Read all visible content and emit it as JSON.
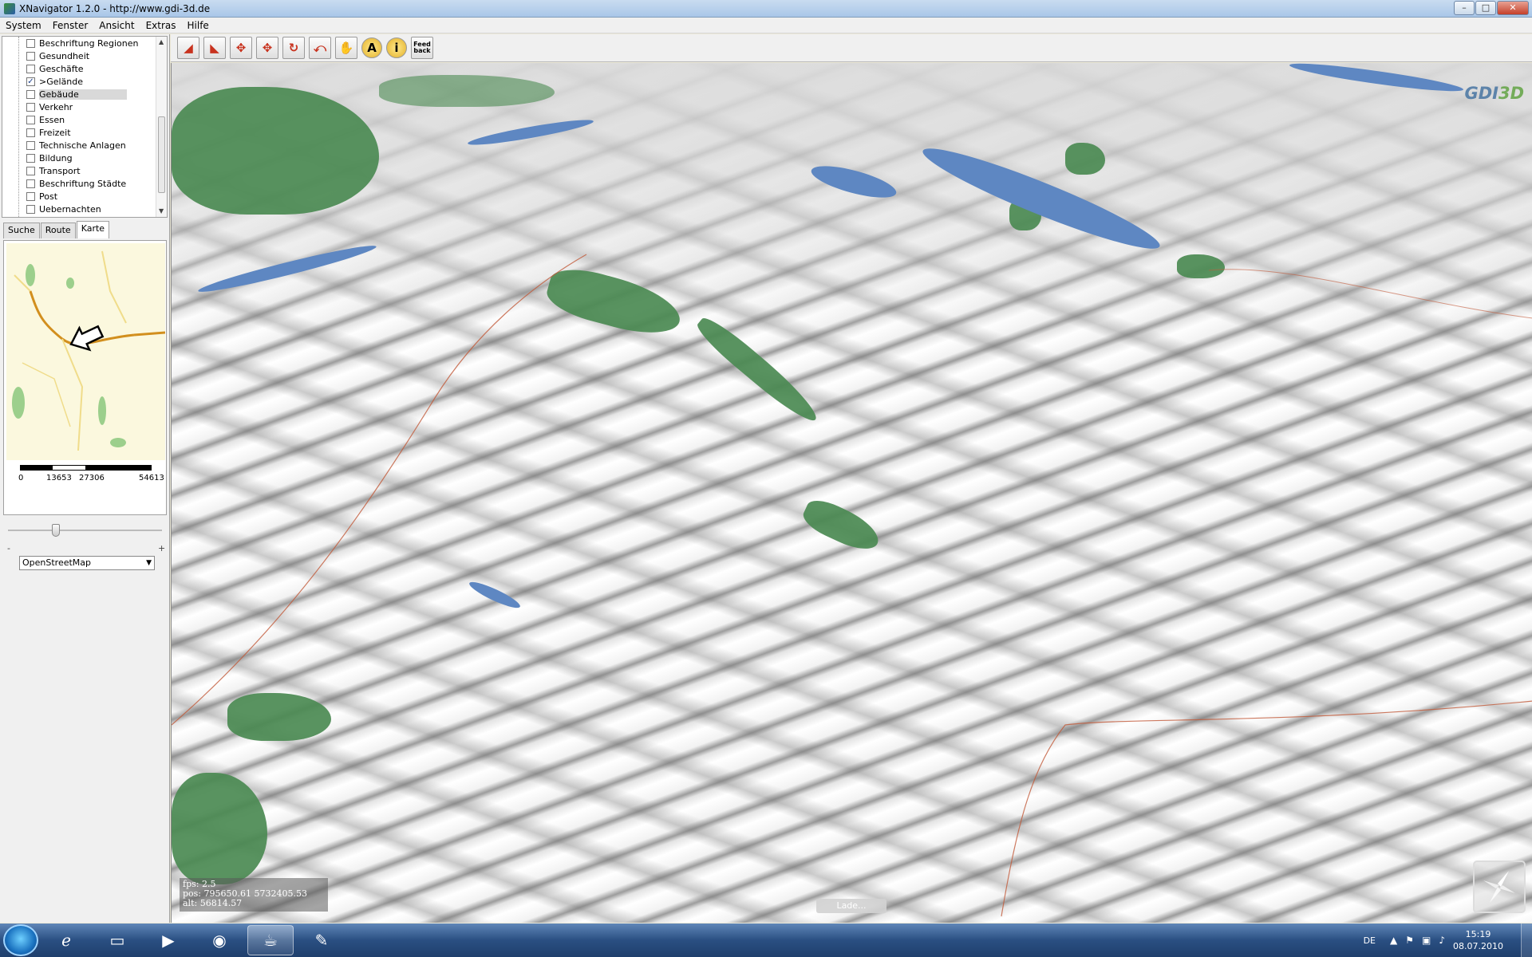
{
  "window": {
    "title": "XNavigator 1.2.0 - http://www.gdi-3d.de",
    "controls": {
      "minimize": "–",
      "maximize": "□",
      "close": "✕"
    }
  },
  "menubar": {
    "items": [
      "System",
      "Fenster",
      "Ansicht",
      "Extras",
      "Hilfe"
    ]
  },
  "layers": [
    {
      "label": "Beschriftung Regionen",
      "checked": false,
      "selected": false
    },
    {
      "label": "Gesundheit",
      "checked": false,
      "selected": false
    },
    {
      "label": "Geschäfte",
      "checked": false,
      "selected": false
    },
    {
      "label": ">Gelände",
      "checked": true,
      "selected": false
    },
    {
      "label": "Gebäude",
      "checked": false,
      "selected": true
    },
    {
      "label": "Verkehr",
      "checked": false,
      "selected": false
    },
    {
      "label": "Essen",
      "checked": false,
      "selected": false
    },
    {
      "label": "Freizeit",
      "checked": false,
      "selected": false
    },
    {
      "label": "Technische Anlagen",
      "checked": false,
      "selected": false
    },
    {
      "label": "Bildung",
      "checked": false,
      "selected": false
    },
    {
      "label": "Transport",
      "checked": false,
      "selected": false
    },
    {
      "label": "Beschriftung Städte",
      "checked": false,
      "selected": false
    },
    {
      "label": "Post",
      "checked": false,
      "selected": false
    },
    {
      "label": "Uebernachten",
      "checked": false,
      "selected": false
    }
  ],
  "tabs": {
    "search": "Suche",
    "route": "Route",
    "map": "Karte",
    "active": "map"
  },
  "minimap": {
    "scale_labels": {
      "a": "0",
      "b": "13653",
      "c": "27306",
      "d": "54613"
    },
    "zoom_minus": "-",
    "zoom_plus": "+",
    "zoom_fraction": 0.3,
    "map_source": "OpenStreetMap"
  },
  "toolbar": {
    "buttons": [
      {
        "name": "tilt-down-icon",
        "glyph": "◢"
      },
      {
        "name": "tilt-up-icon",
        "glyph": "◣"
      },
      {
        "name": "move-horizontal-icon",
        "glyph": "✥"
      },
      {
        "name": "move-vertical-icon",
        "glyph": "✥"
      },
      {
        "name": "rotate-icon",
        "glyph": "↻"
      },
      {
        "name": "reset-icon",
        "glyph": "⤺"
      },
      {
        "name": "pan-hand-icon",
        "glyph": "✋"
      }
    ],
    "label_button": "A",
    "info_button": "i",
    "feedback_button": "Feed back"
  },
  "viewport": {
    "logo_gdi": "GDI",
    "logo_3d": "3D",
    "hud_fps": "fps: 2.5",
    "hud_pos": "pos: 795650.61  5732405.53",
    "hud_alt": "alt: 56814.57",
    "loading": "Lade..."
  },
  "taskbar": {
    "lang": "DE",
    "time": "15:19",
    "date": "08.07.2010"
  },
  "colors": {
    "forest": "#4b8a52",
    "water": "#5e87c2",
    "toolbar_accent": "#c8321e"
  }
}
